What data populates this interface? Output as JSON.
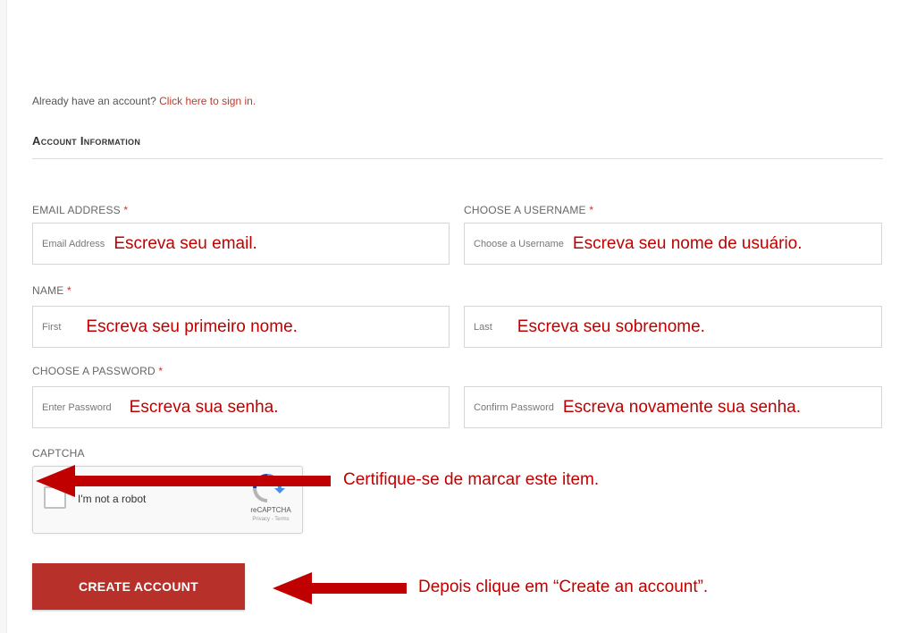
{
  "signin": {
    "prompt": "Already have an account?",
    "link": "Click here to sign in."
  },
  "section_title": "Account Information",
  "fields": {
    "email": {
      "label": "EMAIL ADDRESS",
      "placeholder": "Email Address",
      "hint": "Escreva seu email."
    },
    "username": {
      "label": "CHOOSE A USERNAME",
      "placeholder": "Choose a Username",
      "hint": "Escreva seu nome de usuário."
    },
    "name": {
      "label": "NAME",
      "first_placeholder": "First",
      "first_hint": "Escreva seu primeiro nome.",
      "last_placeholder": "Last",
      "last_hint": "Escreva seu sobrenome."
    },
    "password": {
      "label": "CHOOSE A PASSWORD",
      "placeholder": "Enter Password",
      "hint": "Escreva sua senha.",
      "confirm_placeholder": "Confirm Password",
      "confirm_hint": "Escreva novamente sua senha."
    },
    "required_mark": "*"
  },
  "captcha": {
    "label": "CAPTCHA",
    "checkbox_text": "I'm not a robot",
    "brand": "reCAPTCHA",
    "terms": "Privacy - Terms"
  },
  "create_button": "CREATE ACCOUNT",
  "annotations": {
    "captcha": "Certifique-se de marcar este item.",
    "button": "Depois clique em “Create an account”."
  },
  "colors": {
    "brand_red": "#b8302a",
    "annotation_red": "#c00000",
    "arrow_red": "#c00000"
  }
}
